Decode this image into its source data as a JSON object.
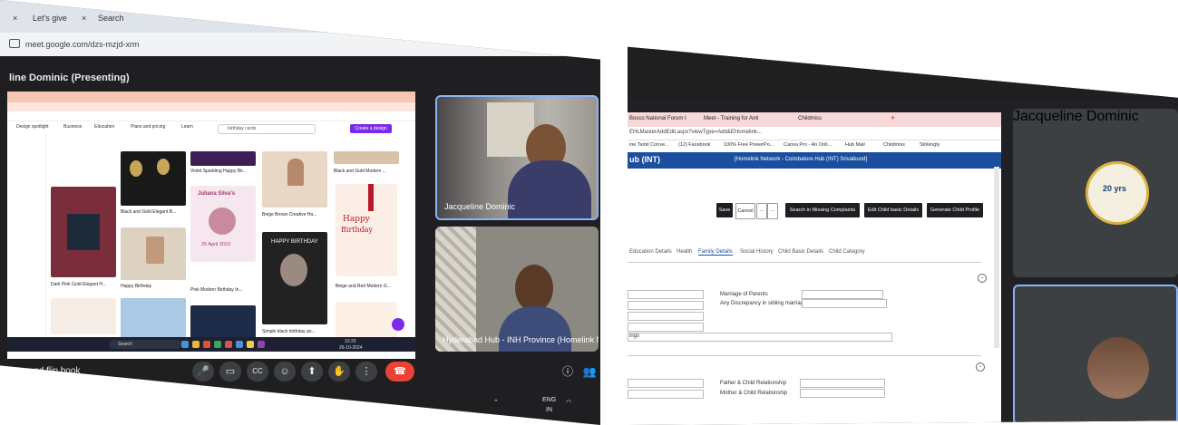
{
  "left": {
    "browser_tabs": [
      "Let's give",
      "Search"
    ],
    "url": "meet.google.com/dzs-mzjd-xrm",
    "meeting_title": "line Dominic (Presenting)",
    "shared_screen": {
      "toolbar": [
        "Design spotlight",
        "Business",
        "Education",
        "Plans and pricing",
        "Learn"
      ],
      "search_placeholder": "birthday cards",
      "create_button": "Create a design",
      "cards": [
        {
          "title": "Violet Sparkling Happy Bir..."
        },
        {
          "title": "Black and Gold Modern ..."
        },
        {
          "title": "Black and Gold Elegant B..."
        },
        {
          "title": "Juliana Silva's"
        },
        {
          "title": "Beige Brown Creative Ha..."
        },
        {
          "title": "Happy Birthday"
        },
        {
          "title": "Pink Modern Birthday In..."
        },
        {
          "title": "Dark Pink Gold Elegant H..."
        },
        {
          "title": "Beige and Red Modern G..."
        },
        {
          "title": "Simple black birthday an..."
        },
        {
          "title": "HAPPY BIRTHDAY"
        },
        {
          "title": "25 April 2023"
        }
      ],
      "taskbar_search": "Search",
      "tray_time": "10:25",
      "tray_date": "26-10-2024"
    },
    "participants": [
      {
        "name": "Jacqueline Dominic"
      },
      {
        "name": "Hyderabad Hub - INH Province (Homelink N"
      }
    ],
    "caption": "...ve and flip book",
    "controls": {
      "mic": "🎤",
      "camera": "▭",
      "cc": "CC",
      "emoji": "☺",
      "present": "⬆",
      "hand": "✋",
      "more": "⋮",
      "end": "☎"
    },
    "system": {
      "lang": "ENG",
      "region": "IN"
    }
  },
  "right": {
    "browser_tabs": [
      "Bosco National Forum I",
      "Meet - Training for Anti",
      "Childmiss"
    ],
    "url": "EHLMasterAddEdit.aspx?viewType=Add&EHomelink...",
    "bookmarks": [
      "ine Tamil Conve...",
      "(12) Facebook",
      "100% Free PowerPo...",
      "Canva Pro - An Onli...",
      "Hub Mail",
      "Childmiss",
      "Strikingly"
    ],
    "app_header": "ub (INT)",
    "app_center": "[Homelink Network - Coimbatore Hub (INT) Srivaikund]",
    "buttons": [
      "Save",
      "Cancel",
      "Search in Missing Complaints",
      "Edit Child basic Details",
      "Generate Child Profile"
    ],
    "tabs": [
      "Education Details",
      "Health",
      "Family Details",
      "Social History",
      "Child Basic Details",
      "Child Category"
    ],
    "fields": [
      {
        "label": "Marriage of Parents"
      },
      {
        "label": "Any Discrepancy in sibling marriages"
      },
      {
        "label": "Father & Child Relationship"
      },
      {
        "label": "Mother & Child Relationship"
      }
    ],
    "partial_label": "ings",
    "participants": [
      {
        "name": "Jacqueline Dominic"
      },
      {
        "name": ""
      }
    ],
    "logo_text": "20 yrs"
  }
}
